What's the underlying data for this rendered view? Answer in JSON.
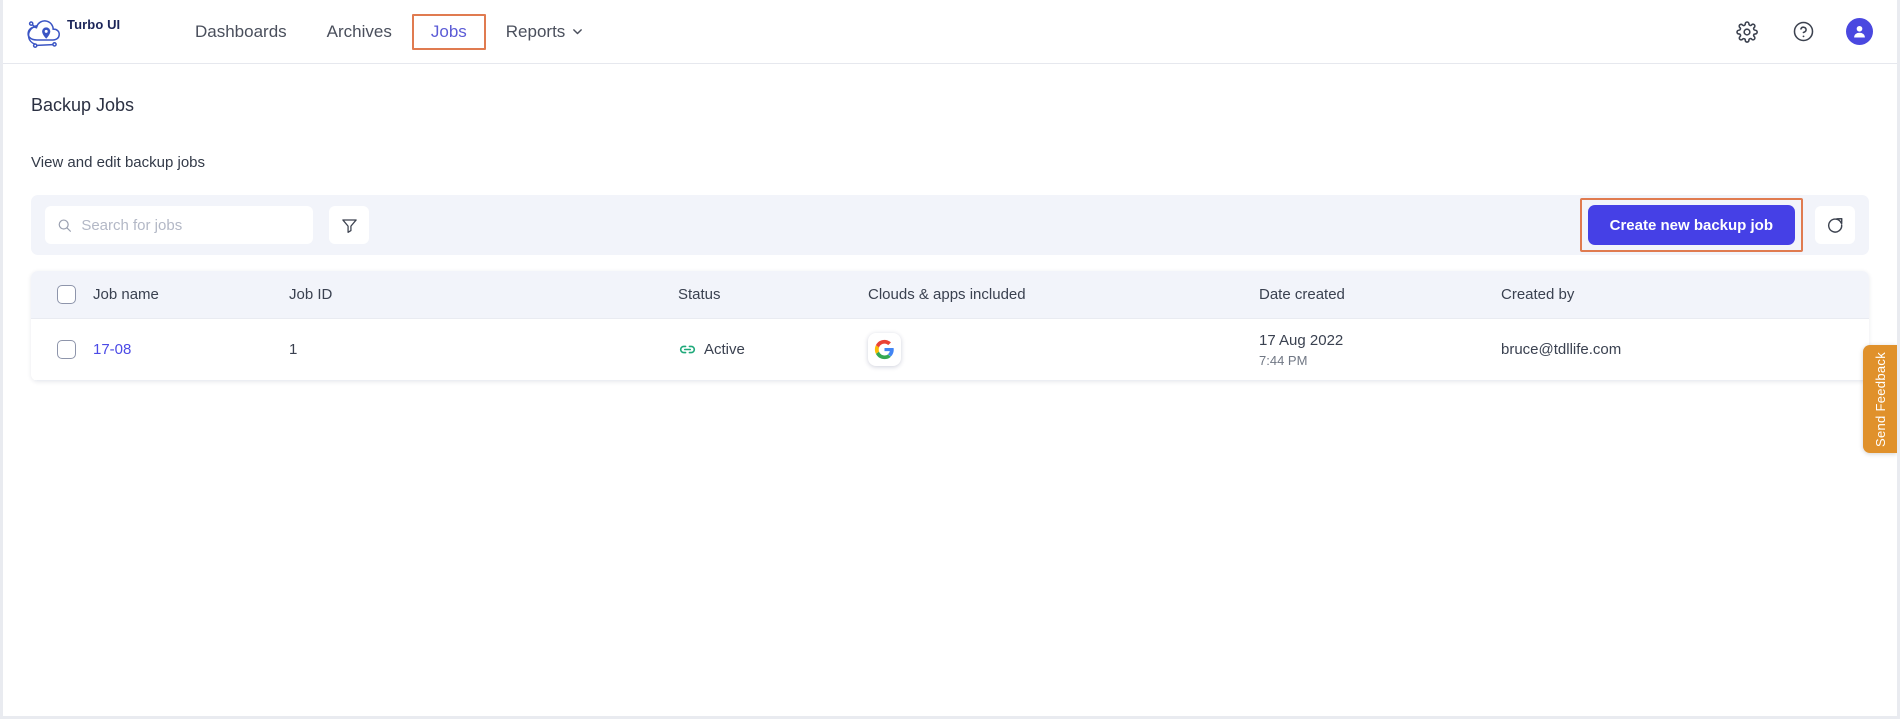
{
  "brand": {
    "name": "Turbo UI",
    "logo_icon": "cloud-pin-network-icon"
  },
  "nav": {
    "items": [
      {
        "label": "Dashboards",
        "active": false,
        "has_caret": false
      },
      {
        "label": "Archives",
        "active": false,
        "has_caret": false
      },
      {
        "label": "Jobs",
        "active": true,
        "has_caret": false
      },
      {
        "label": "Reports",
        "active": false,
        "has_caret": true
      }
    ],
    "right_icons": [
      {
        "name": "gear-icon"
      },
      {
        "name": "help-circle-icon"
      },
      {
        "name": "user-avatar-icon"
      }
    ]
  },
  "page": {
    "title": "Backup Jobs",
    "subtitle": "View and edit backup jobs"
  },
  "toolbar": {
    "search_placeholder": "Search for jobs",
    "search_value": "",
    "search_icon": "search-icon",
    "filter_icon": "funnel-filter-icon",
    "create_label": "Create new backup job",
    "refresh_icon": "refresh-icon"
  },
  "table": {
    "columns": [
      "Job name",
      "Job ID",
      "Status",
      "Clouds & apps included",
      "Date created",
      "Created by"
    ],
    "rows": [
      {
        "job_name": "17-08",
        "job_id": "1",
        "status": "Active",
        "status_icon": "link-chain-icon",
        "app_icon": "google-icon",
        "date_created": "17 Aug 2022",
        "time_created": "7:44 PM",
        "created_by": "bruce@tdllife.com"
      }
    ]
  },
  "feedback": {
    "label": "Send Feedback"
  },
  "colors": {
    "accent_blue": "#4540e6",
    "link_blue": "#4b4ae6",
    "highlight_orange": "#e07b50",
    "status_green": "#1fa97a",
    "feedback_orange": "#e0912b",
    "toolbar_gray": "#f2f4fa"
  }
}
